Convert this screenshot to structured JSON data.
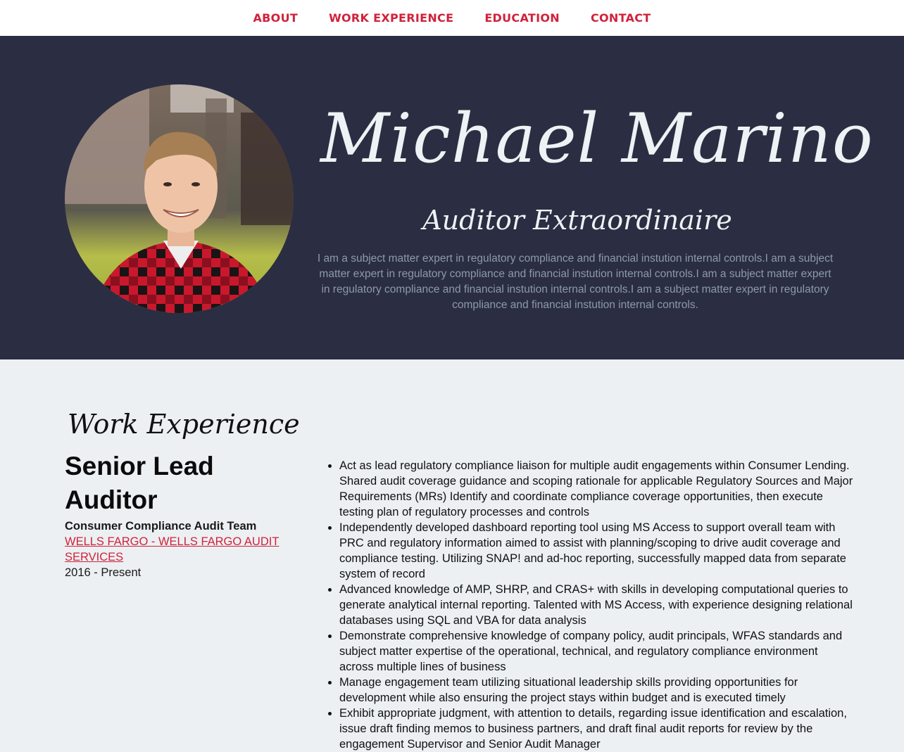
{
  "nav": {
    "items": [
      {
        "label": "ABOUT"
      },
      {
        "label": "WORK EXPERIENCE"
      },
      {
        "label": "EDUCATION"
      },
      {
        "label": "CONTACT"
      }
    ]
  },
  "hero": {
    "name": "Michael Marino",
    "subtitle": "Auditor Extraordinaire",
    "bio": "I am a subject matter expert in regulatory compliance and financial instution internal controls.I am a subject matter expert in regulatory compliance and financial instution internal controls.I am a subject matter expert in regulatory compliance and financial instution internal controls.I am a subject matter expert in regulatory compliance and financial instution internal controls."
  },
  "work": {
    "section_title": "Work Experience",
    "job": {
      "title": "Senior Lead Auditor",
      "team": "Consumer Compliance Audit Team",
      "company": "WELLS FARGO - WELLS FARGO AUDIT SERVICES",
      "dates": "2016 - Present",
      "duties": [
        "Act as lead regulatory compliance liaison for multiple audit engagements within Consumer Lending. Shared audit coverage guidance and scoping rationale for applicable Regulatory Sources and Major Requirements (MRs) Identify and coordinate compliance coverage opportunities, then execute testing plan of regulatory processes and controls",
        "Independently developed dashboard reporting tool using MS Access to support overall team with PRC and regulatory information aimed to assist with planning/scoping to drive audit coverage and compliance testing. Utilizing SNAP! and ad-hoc reporting, successfully mapped data from separate system of record",
        "Advanced knowledge of AMP, SHRP, and CRAS+ with skills in developing computational queries to generate analytical internal reporting. Talented with MS Access, with experience designing relational databases using SQL and VBA for data analysis",
        "Demonstrate comprehensive knowledge of company policy, audit principals, WFAS standards and subject matter expertise of the operational, technical, and regulatory compliance environment across multiple lines of business",
        "Manage engagement team utilizing situational leadership skills providing opportunities for development while also ensuring the project stays within budget and is executed timely",
        "Exhibit appropriate judgment, with attention to details, regarding issue identification and escalation, issue draft finding memos to business partners, and draft final audit reports for review by the engagement Supervisor and Senior Audit Manager"
      ]
    }
  },
  "colors": {
    "accent": "#d0223c",
    "hero_bg": "#2b2d42",
    "hero_text": "#edf2f4",
    "bio_text": "#8d99ae",
    "page_bg": "#ecf0f2"
  }
}
